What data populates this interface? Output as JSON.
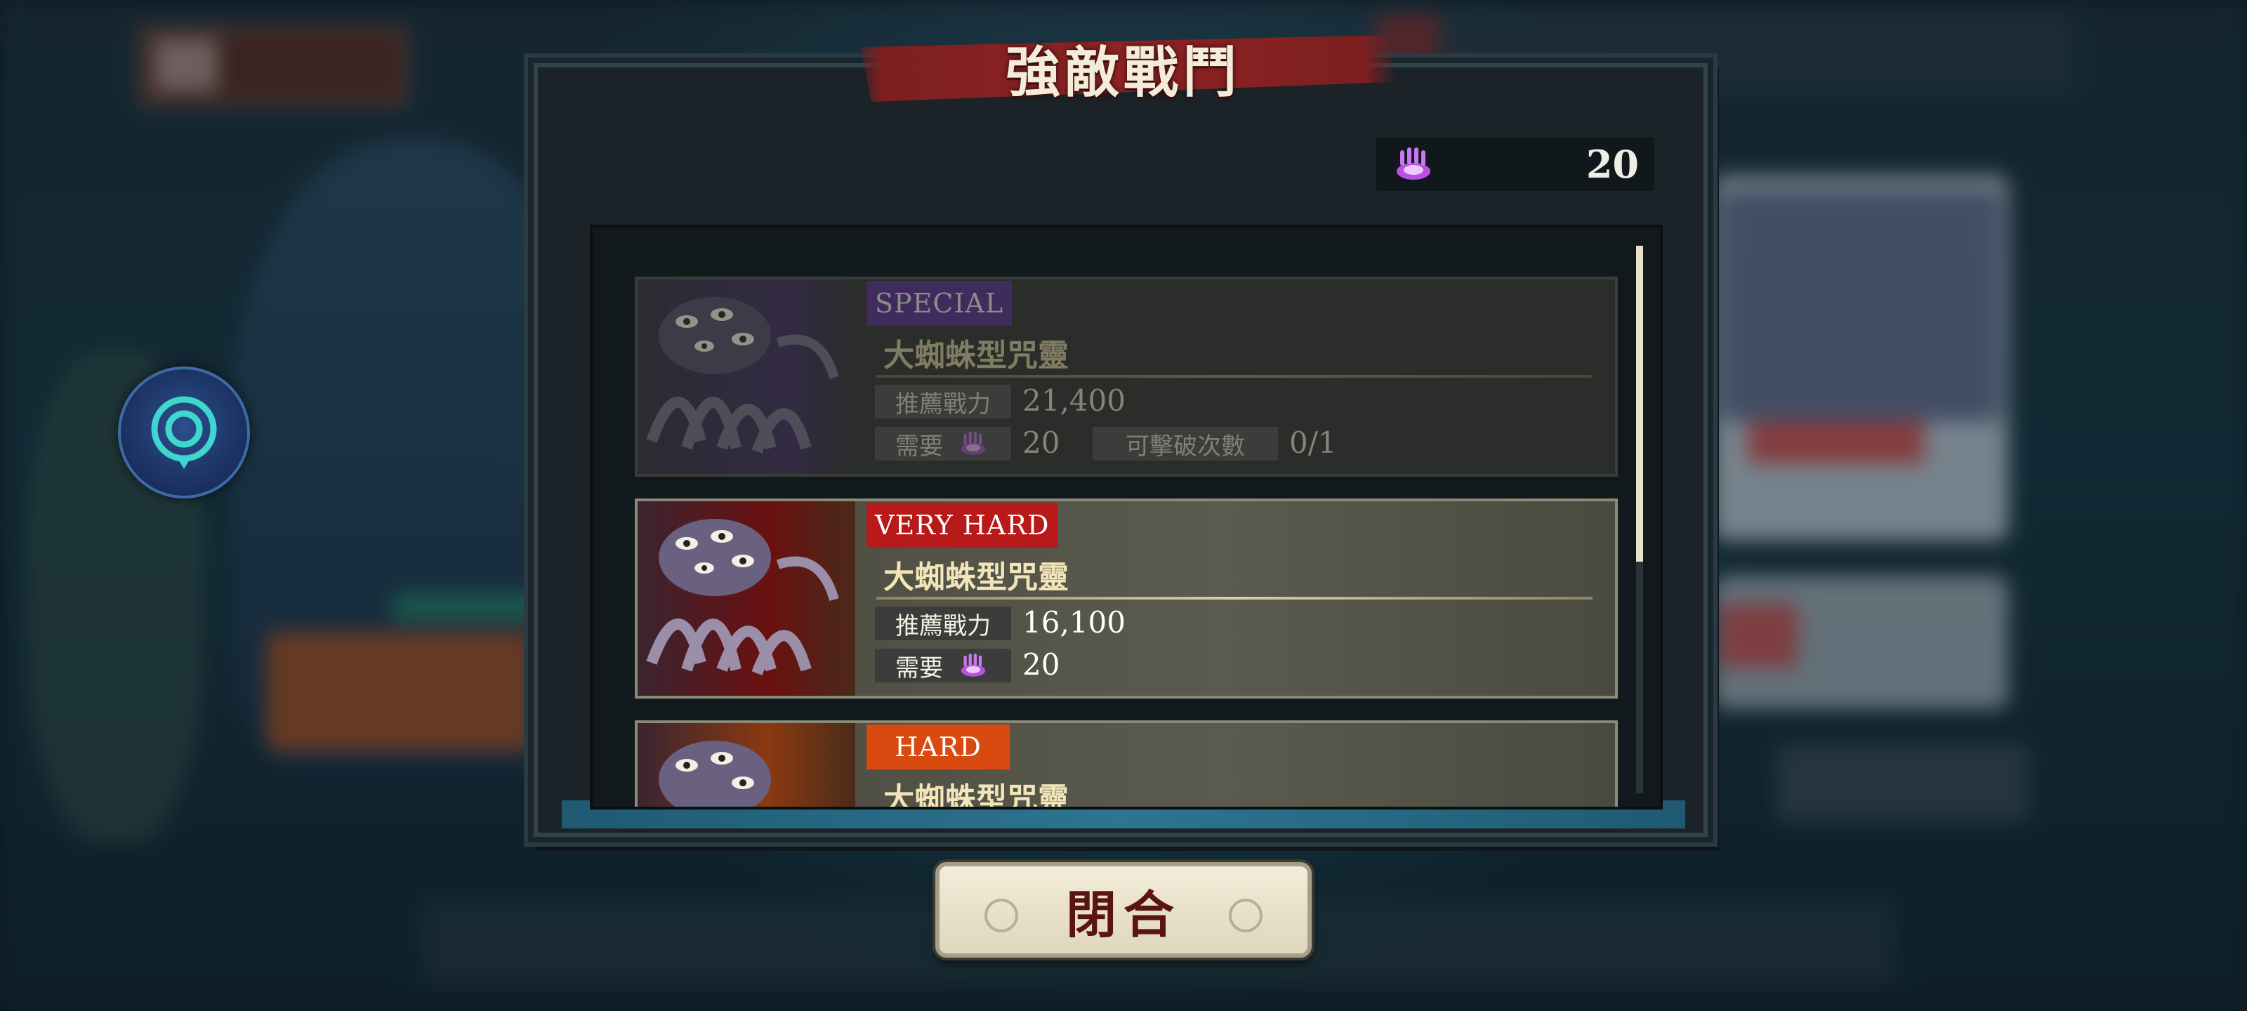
{
  "title": "強敵戰鬥",
  "currency": {
    "icon": "cursed-hand-icon",
    "value": "20"
  },
  "battles": [
    {
      "difficulty": "SPECIAL",
      "difficulty_color": "#5b2a9c",
      "enemy_name": "大蜘蛛型咒靈",
      "power_label": "推薦戰力",
      "power_value": "21,400",
      "cost_label": "需要",
      "cost_value": "20",
      "attempts_label": "可擊破次數",
      "attempts_value": "0/1",
      "disabled": true
    },
    {
      "difficulty": "VERY HARD",
      "difficulty_color": "#b81a1a",
      "enemy_name": "大蜘蛛型咒靈",
      "power_label": "推薦戰力",
      "power_value": "16,100",
      "cost_label": "需要",
      "cost_value": "20",
      "disabled": false
    },
    {
      "difficulty": "HARD",
      "difficulty_color": "#d94a10",
      "enemy_name": "大蜘蛛型咒靈",
      "disabled": false
    }
  ],
  "close_label": "閉合"
}
